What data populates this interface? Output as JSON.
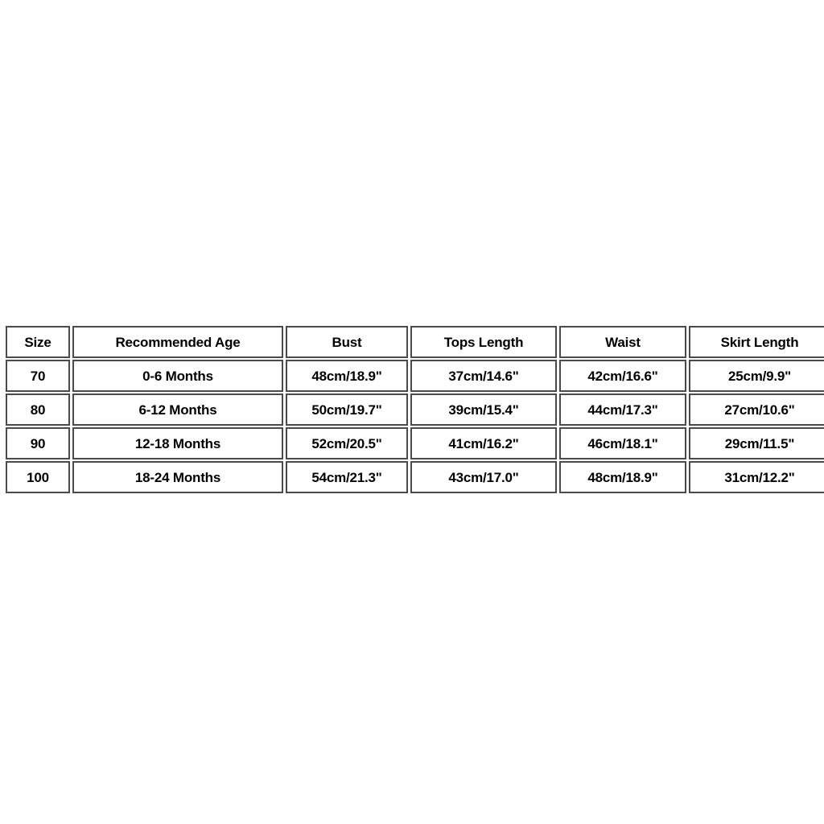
{
  "chart_data": {
    "type": "table",
    "title": "",
    "columns": [
      "Size",
      "Recommended Age",
      "Bust",
      "Tops Length",
      "Waist",
      "Skirt Length"
    ],
    "rows": [
      [
        "70",
        "0-6 Months",
        "48cm/18.9\"",
        "37cm/14.6\"",
        "42cm/16.6\"",
        "25cm/9.9\""
      ],
      [
        "80",
        "6-12 Months",
        "50cm/19.7\"",
        "39cm/15.4\"",
        "44cm/17.3\"",
        "27cm/10.6\""
      ],
      [
        "90",
        "12-18 Months",
        "52cm/20.5\"",
        "41cm/16.2\"",
        "46cm/18.1\"",
        "29cm/11.5\""
      ],
      [
        "100",
        "18-24 Months",
        "54cm/21.3\"",
        "43cm/17.0\"",
        "48cm/18.9\"",
        "31cm/12.2\""
      ]
    ]
  },
  "table": {
    "headers": {
      "size": "Size",
      "age": "Recommended Age",
      "bust": "Bust",
      "tops_length": "Tops Length",
      "waist": "Waist",
      "skirt_length": "Skirt Length"
    },
    "rows": [
      {
        "size": "70",
        "age": "0-6 Months",
        "bust": "48cm/18.9\"",
        "tops_length": "37cm/14.6\"",
        "waist": "42cm/16.6\"",
        "skirt_length": "25cm/9.9\""
      },
      {
        "size": "80",
        "age": "6-12 Months",
        "bust": "50cm/19.7\"",
        "tops_length": "39cm/15.4\"",
        "waist": "44cm/17.3\"",
        "skirt_length": "27cm/10.6\""
      },
      {
        "size": "90",
        "age": "12-18 Months",
        "bust": "52cm/20.5\"",
        "tops_length": "41cm/16.2\"",
        "waist": "46cm/18.1\"",
        "skirt_length": "29cm/11.5\""
      },
      {
        "size": "100",
        "age": "18-24 Months",
        "bust": "54cm/21.3\"",
        "tops_length": "43cm/17.0\"",
        "waist": "48cm/18.9\"",
        "skirt_length": "31cm/12.2\""
      }
    ]
  },
  "colors": {
    "background": "#ffffff",
    "cell_background": "#ffffff",
    "cell_border": "#4a4a4a",
    "text": "#000000"
  }
}
